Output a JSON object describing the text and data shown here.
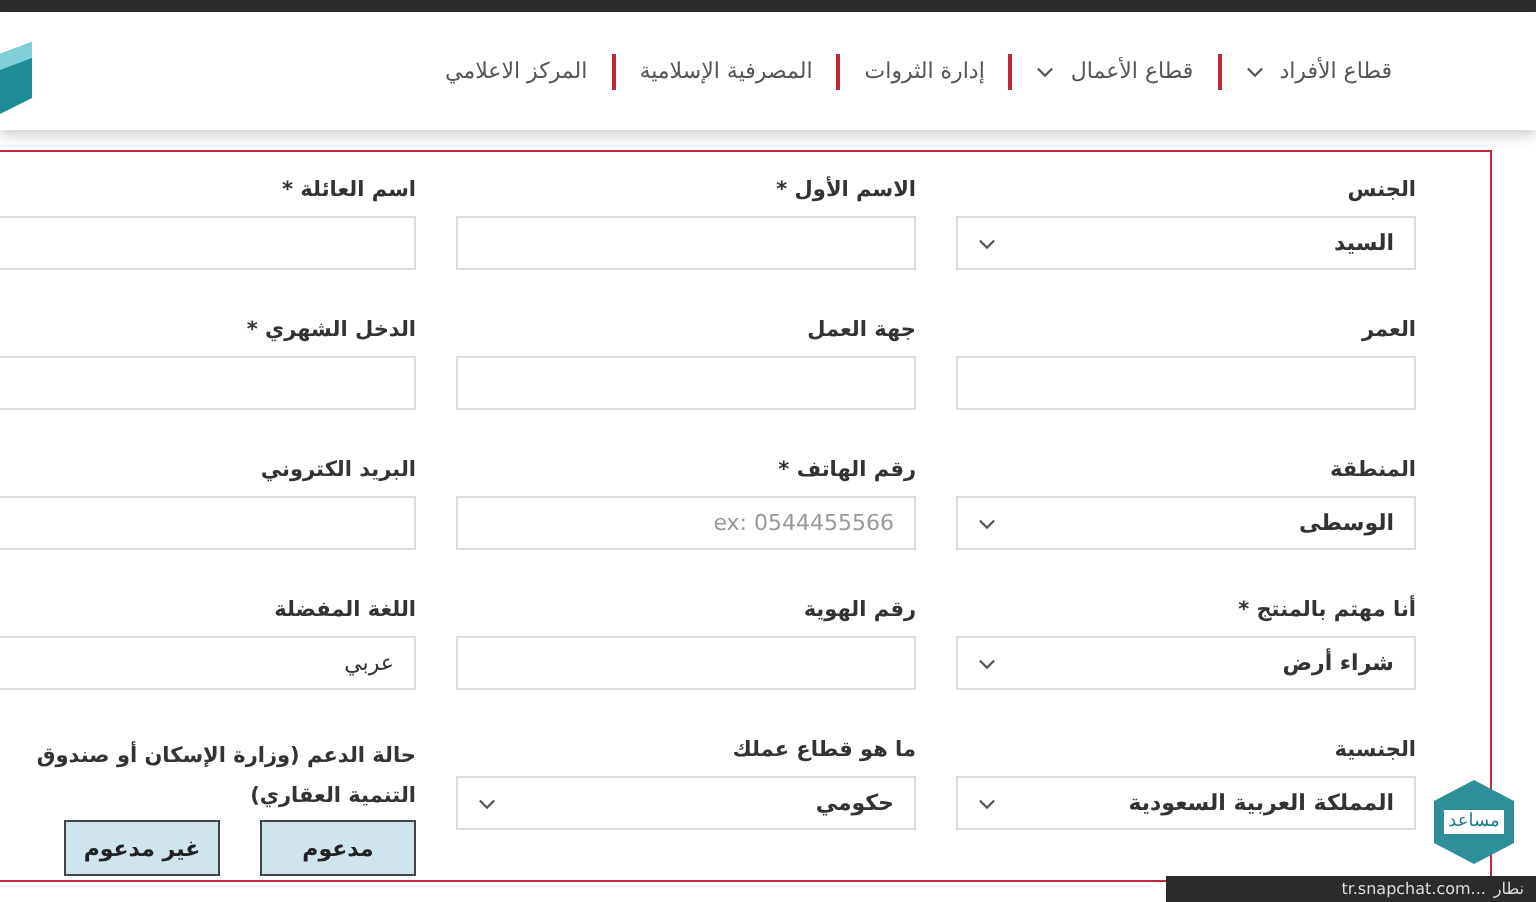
{
  "nav": [
    {
      "label": "قطاع الأفراد",
      "dropdown": true
    },
    {
      "label": "قطاع الأعمال",
      "dropdown": true
    },
    {
      "label": "إدارة الثروات",
      "dropdown": false
    },
    {
      "label": "المصرفية الإسلامية",
      "dropdown": false
    },
    {
      "label": "المركز الاعلامي",
      "dropdown": false
    }
  ],
  "form": {
    "fields": [
      {
        "label": "الجنس",
        "kind": "select",
        "value": "السيد"
      },
      {
        "label": "الاسم الأول *",
        "kind": "text"
      },
      {
        "label": "اسم العائلة *",
        "kind": "text"
      },
      {
        "label": "العمر",
        "kind": "text"
      },
      {
        "label": "جهة العمل",
        "kind": "text"
      },
      {
        "label": "الدخل الشهري *",
        "kind": "text"
      },
      {
        "label": "المنطقة",
        "kind": "select",
        "value": "الوسطى"
      },
      {
        "label": "رقم الهاتف *",
        "kind": "text",
        "placeholder": "ex: 0544455566"
      },
      {
        "label": "البريد الكتروني",
        "kind": "text"
      },
      {
        "label": "أنا مهتم بالمنتج *",
        "kind": "select",
        "value": "شراء أرض"
      },
      {
        "label": "رقم الهوية",
        "kind": "text"
      },
      {
        "label": "اللغة المفضلة",
        "kind": "text",
        "value": "عربي"
      },
      {
        "label": "الجنسية",
        "kind": "select",
        "value": "المملكة العربية السعودية"
      },
      {
        "label": "ما هو قطاع عملك",
        "kind": "select",
        "value": "حكومي"
      },
      {
        "label": "حالة الدعم (وزارة الإسكان أو صندوق التنمية العقاري)",
        "kind": "buttons",
        "options": [
          "مدعوم",
          "غير مدعوم"
        ]
      }
    ]
  },
  "helper_badge": {
    "label": "مساعد"
  },
  "status_bar": {
    "url": "tr.snapchat.com...",
    "word": "نطار"
  }
}
